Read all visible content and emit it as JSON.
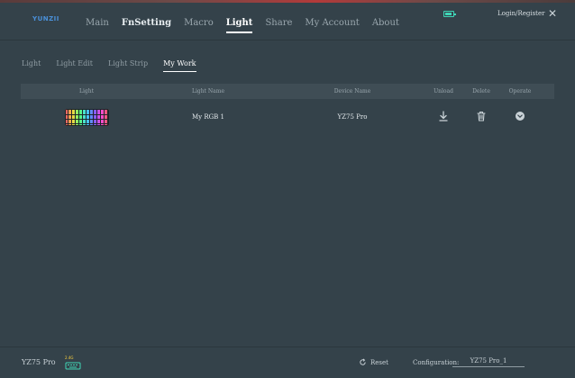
{
  "app": {
    "logo": "YUNZII"
  },
  "nav": [
    "Main",
    "FnSetting",
    "Macro",
    "Light",
    "Share",
    "My Account",
    "About"
  ],
  "header": {
    "login": "Login/Register"
  },
  "subnav": [
    "Light",
    "Light Edit",
    "Light Strip",
    "My Work"
  ],
  "table": {
    "columns": [
      "Light",
      "Light Name",
      "Device Name",
      "Unload",
      "Delete",
      "Operate"
    ],
    "rows": [
      {
        "light_name": "My RGB 1",
        "device_name": "YZ75 Pro"
      }
    ]
  },
  "footer": {
    "device": "YZ75 Pro",
    "connection": "2.4G",
    "reset": "Reset",
    "config_label": "Configuration:",
    "config_value": "YZ75 Pro_1"
  },
  "colors": {
    "background": "#34424a",
    "accent": "#3fd6b7",
    "logo": "#4a90d9"
  },
  "icons": [
    "battery-icon",
    "close-icon",
    "download-icon",
    "trash-icon",
    "chevron-down-icon",
    "reset-icon",
    "keyboard-icon"
  ]
}
